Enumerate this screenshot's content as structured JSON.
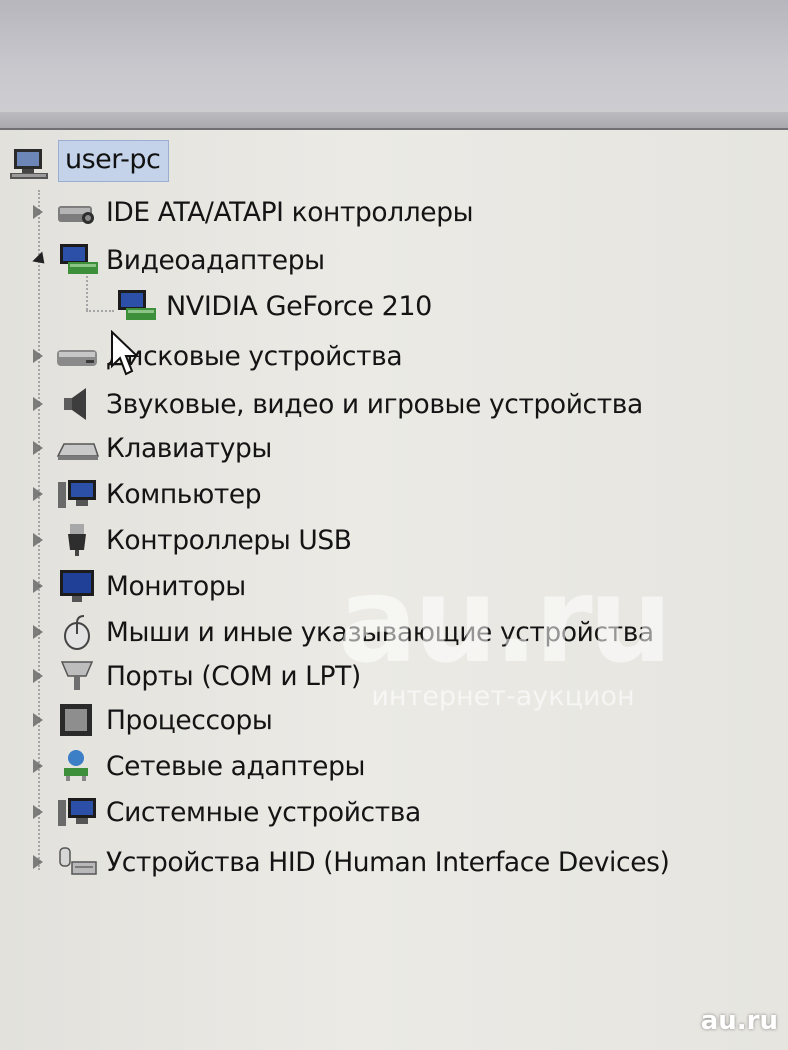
{
  "tree": {
    "root": {
      "label": "user-pc",
      "icon": "computer-icon"
    },
    "categories": [
      {
        "label": "IDE ATA/ATAPI контроллеры",
        "icon": "ide-controller-icon",
        "expanded": false
      },
      {
        "label": "Видеоадаптеры",
        "icon": "display-adapter-icon",
        "expanded": true,
        "children": [
          {
            "label": "NVIDIA GeForce 210",
            "icon": "display-adapter-icon"
          }
        ]
      },
      {
        "label": "Дисковые устройства",
        "icon": "disk-drive-icon",
        "expanded": false
      },
      {
        "label": "Звуковые, видео и игровые устройства",
        "icon": "speaker-icon",
        "expanded": false
      },
      {
        "label": "Клавиатуры",
        "icon": "keyboard-icon",
        "expanded": false
      },
      {
        "label": "Компьютер",
        "icon": "computer-icon",
        "expanded": false
      },
      {
        "label": "Контроллеры USB",
        "icon": "usb-plug-icon",
        "expanded": false
      },
      {
        "label": "Мониторы",
        "icon": "monitor-icon",
        "expanded": false
      },
      {
        "label": "Мыши и иные указывающие устройства",
        "icon": "mouse-icon",
        "expanded": false
      },
      {
        "label": "Порты (COM и LPT)",
        "icon": "port-icon",
        "expanded": false
      },
      {
        "label": "Процессоры",
        "icon": "processor-icon",
        "expanded": false
      },
      {
        "label": "Сетевые адаптеры",
        "icon": "network-adapter-icon",
        "expanded": false
      },
      {
        "label": "Системные устройства",
        "icon": "system-devices-icon",
        "expanded": false
      },
      {
        "label": "Устройства HID (Human Interface Devices)",
        "icon": "hid-icon",
        "expanded": false
      }
    ]
  },
  "watermark": {
    "big": "au.ru",
    "small": "интернет-аукцион",
    "corner": "au.ru"
  },
  "colors": {
    "selection": "#c4d3ea",
    "background": "#e9e8e4",
    "text": "#141414"
  }
}
